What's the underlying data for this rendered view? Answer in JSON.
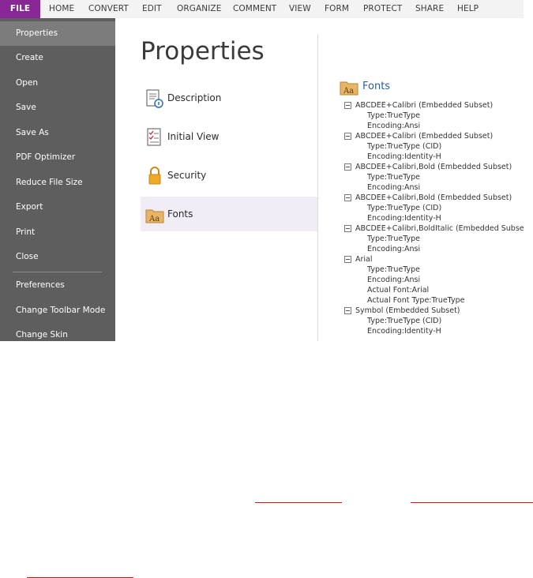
{
  "menu": [
    {
      "label": "FILE",
      "active": true
    },
    {
      "label": "HOME"
    },
    {
      "label": "CONVERT"
    },
    {
      "label": "EDIT"
    },
    {
      "label": "ORGANIZE"
    },
    {
      "label": "COMMENT"
    },
    {
      "label": "VIEW"
    },
    {
      "label": "FORM"
    },
    {
      "label": "PROTECT"
    },
    {
      "label": "SHARE"
    },
    {
      "label": "HELP"
    }
  ],
  "sidebar": {
    "items": [
      {
        "label": "Properties",
        "active": true
      },
      {
        "label": "Create"
      },
      {
        "label": "Open"
      },
      {
        "label": "Save"
      },
      {
        "label": "Save As"
      },
      {
        "label": "PDF Optimizer"
      },
      {
        "label": "Reduce File Size"
      },
      {
        "label": "Export"
      },
      {
        "label": "Print"
      },
      {
        "label": "Close"
      },
      {
        "label": "Preferences"
      },
      {
        "label": "Change Toolbar Mode"
      },
      {
        "label": "Change Skin"
      }
    ]
  },
  "main": {
    "title": "Properties",
    "nav": [
      {
        "label": "Description",
        "icon": "description-icon"
      },
      {
        "label": "Initial View",
        "icon": "initial-view-icon"
      },
      {
        "label": "Security",
        "icon": "lock-icon"
      },
      {
        "label": "Fonts",
        "icon": "fonts-icon",
        "active": true
      }
    ]
  },
  "fonts_panel": {
    "title": "Fonts",
    "fonts": [
      {
        "name": "ABCDEE+Calibri (Embedded Subset)",
        "props": [
          "Type:TrueType",
          "Encoding:Ansi"
        ]
      },
      {
        "name": "ABCDEE+Calibri (Embedded Subset)",
        "props": [
          "Type:TrueType (CID)",
          "Encoding:Identity-H"
        ]
      },
      {
        "name": "ABCDEE+Calibri,Bold (Embedded Subset)",
        "props": [
          "Type:TrueType",
          "Encoding:Ansi"
        ]
      },
      {
        "name": "ABCDEE+Calibri,Bold (Embedded Subset)",
        "props": [
          "Type:TrueType (CID)",
          "Encoding:Identity-H"
        ]
      },
      {
        "name": "ABCDEE+Calibri,BoldItalic (Embedded Subset)",
        "props": [
          "Type:TrueType",
          "Encoding:Ansi"
        ]
      },
      {
        "name": "Arial",
        "props": [
          "Type:TrueType",
          "Encoding:Ansi",
          "Actual Font:Arial",
          "Actual Font Type:TrueType"
        ]
      },
      {
        "name": "Symbol (Embedded Subset)",
        "props": [
          "Type:TrueType (CID)",
          "Encoding:Identity-H"
        ]
      }
    ]
  },
  "colors": {
    "accent": "#8a2796",
    "sidebar": "#5e5e5e",
    "sidebar_active": "#7c7c7c",
    "nav_active": "#f1ecf5",
    "link_title": "#2e5e9c",
    "redline": "#c61a1a"
  }
}
